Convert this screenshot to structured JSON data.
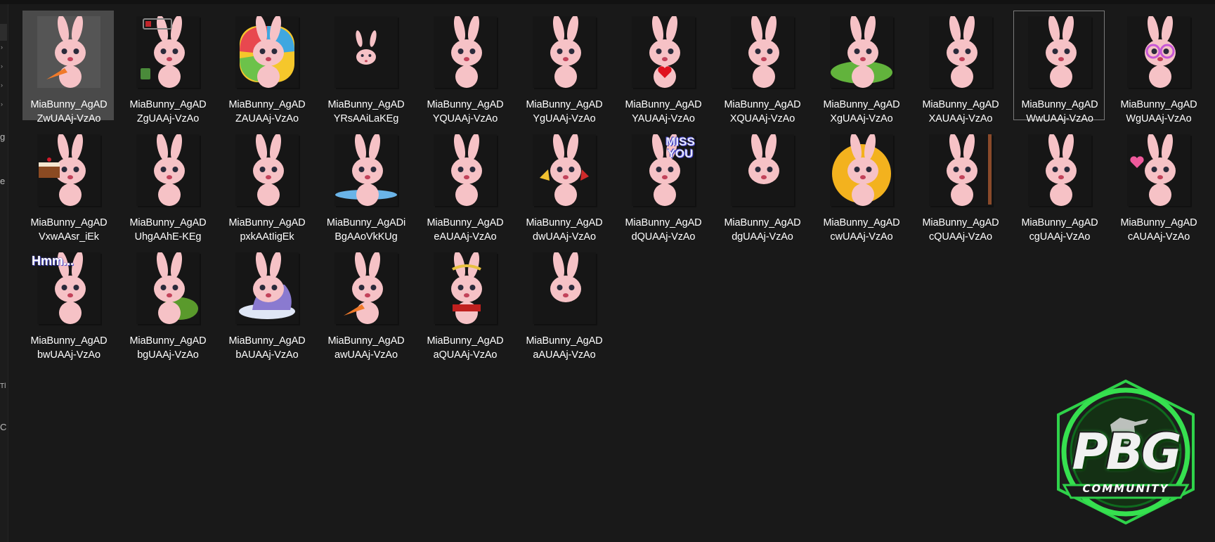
{
  "nav": {
    "fragments": [
      "g",
      "e",
      "Tl",
      "C"
    ]
  },
  "files": [
    {
      "label": "MiaBunny_AgAD\nZwUAAj-VzAo",
      "selected": true,
      "hover": false,
      "accent": "#f07a2a",
      "variant": "carrot"
    },
    {
      "label": "MiaBunny_AgAD\nZgUAAj-VzAo",
      "selected": false,
      "hover": false,
      "accent": "#c0252b",
      "variant": "battery"
    },
    {
      "label": "MiaBunny_AgAD\nZAUAAj-VzAo",
      "selected": false,
      "hover": false,
      "accent": "#f5c72b",
      "variant": "rainbow"
    },
    {
      "label": "MiaBunny_AgAD\nYRsAAiLaKEg",
      "selected": false,
      "hover": false,
      "accent": "#f2b6bd",
      "variant": "small"
    },
    {
      "label": "MiaBunny_AgAD\nYQUAAj-VzAo",
      "selected": false,
      "hover": false,
      "accent": "#f2b6bd",
      "variant": "sitting"
    },
    {
      "label": "MiaBunny_AgAD\nYgUAAj-VzAo",
      "selected": false,
      "hover": false,
      "accent": "#6cc8e8",
      "variant": "sad"
    },
    {
      "label": "MiaBunny_AgAD\nYAUAAj-VzAo",
      "selected": false,
      "hover": false,
      "accent": "#e0121f",
      "variant": "heart"
    },
    {
      "label": "MiaBunny_AgAD\nXQUAAj-VzAo",
      "selected": false,
      "hover": false,
      "accent": "#f2b6bd",
      "variant": "grumpy"
    },
    {
      "label": "MiaBunny_AgAD\nXgUAAj-VzAo",
      "selected": false,
      "hover": false,
      "accent": "#62b33c",
      "variant": "grass"
    },
    {
      "label": "MiaBunny_AgAD\nXAUAAj-VzAo",
      "selected": false,
      "hover": false,
      "accent": "#f2b6bd",
      "variant": "laugh"
    },
    {
      "label": "MiaBunny_AgAD\nWwUAAj-VzAo",
      "selected": false,
      "hover": true,
      "accent": "#2a2ab8",
      "variant": "shout"
    },
    {
      "label": "MiaBunny_AgAD\nWgUAAj-VzAo",
      "selected": false,
      "hover": false,
      "accent": "#c657d6",
      "variant": "glasses"
    },
    {
      "label": "MiaBunny_AgAD\nVxwAAsr_iEk",
      "selected": false,
      "hover": false,
      "accent": "#8b4a22",
      "variant": "cake"
    },
    {
      "label": "MiaBunny_AgAD\nUhgAAhE-KEg",
      "selected": false,
      "hover": false,
      "accent": "#f2b6bd",
      "variant": "point"
    },
    {
      "label": "MiaBunny_AgAD\npxkAAtIigEk",
      "selected": false,
      "hover": false,
      "accent": "#f2b6bd",
      "variant": "arms"
    },
    {
      "label": "MiaBunny_AgADi\nBgAAoVkKUg",
      "selected": false,
      "hover": false,
      "accent": "#6ab4e8",
      "variant": "puddle"
    },
    {
      "label": "MiaBunny_AgAD\neAUAAj-VzAo",
      "selected": false,
      "hover": false,
      "accent": "#f2b6bd",
      "variant": "yawn"
    },
    {
      "label": "MiaBunny_AgAD\ndwUAAj-VzAo",
      "selected": false,
      "hover": false,
      "accent": "#f2c230",
      "variant": "party"
    },
    {
      "label": "MiaBunny_AgAD\ndQUAAj-VzAo",
      "selected": false,
      "hover": false,
      "accent": "#4b4bcc",
      "variant": "miss",
      "caption": "MISS YOU"
    },
    {
      "label": "MiaBunny_AgAD\ndgUAAj-VzAo",
      "selected": false,
      "hover": false,
      "accent": "#f2b6bd",
      "variant": "lying"
    },
    {
      "label": "MiaBunny_AgAD\ncwUAAj-VzAo",
      "selected": false,
      "hover": false,
      "accent": "#f3b21e",
      "variant": "sun"
    },
    {
      "label": "MiaBunny_AgAD\ncQUAAj-VzAo",
      "selected": false,
      "hover": false,
      "accent": "#8a4a2a",
      "variant": "door"
    },
    {
      "label": "MiaBunny_AgAD\ncgUAAj-VzAo",
      "selected": false,
      "hover": false,
      "accent": "#f2b6bd",
      "variant": "cheek"
    },
    {
      "label": "MiaBunny_AgAD\ncAUAAj-VzAo",
      "selected": false,
      "hover": false,
      "accent": "#ef5a9c",
      "variant": "love"
    },
    {
      "label": "MiaBunny_AgAD\nbwUAAj-VzAo",
      "selected": false,
      "hover": false,
      "accent": "#4b4bcc",
      "variant": "hmm",
      "caption": "Hmm..."
    },
    {
      "label": "MiaBunny_AgAD\nbgUAAj-VzAo",
      "selected": false,
      "hover": false,
      "accent": "#5a9a2c",
      "variant": "bush"
    },
    {
      "label": "MiaBunny_AgAD\nbAUAAj-VzAo",
      "selected": false,
      "hover": false,
      "accent": "#8a7ad0",
      "variant": "sleep"
    },
    {
      "label": "MiaBunny_AgAD\nawUAAj-VzAo",
      "selected": false,
      "hover": false,
      "accent": "#f07a2a",
      "variant": "stand"
    },
    {
      "label": "MiaBunny_AgAD\naQUAAj-VzAo",
      "selected": false,
      "hover": false,
      "accent": "#c0201f",
      "variant": "toga"
    },
    {
      "label": "MiaBunny_AgAD\naAUAAj-VzAo",
      "selected": false,
      "hover": false,
      "accent": "#6cc8e8",
      "variant": "tired"
    }
  ],
  "watermark": {
    "main_text": "PBG",
    "sub_text": "COMMUNITY",
    "colors": {
      "ring": "#2fd24a",
      "dark": "#1d1d1d",
      "light": "#f1f1f1"
    }
  },
  "colors": {
    "background": "#191919",
    "selection": "#4a4a4a",
    "bunny_pink": "#f6c2c6",
    "text": "#ffffff"
  }
}
